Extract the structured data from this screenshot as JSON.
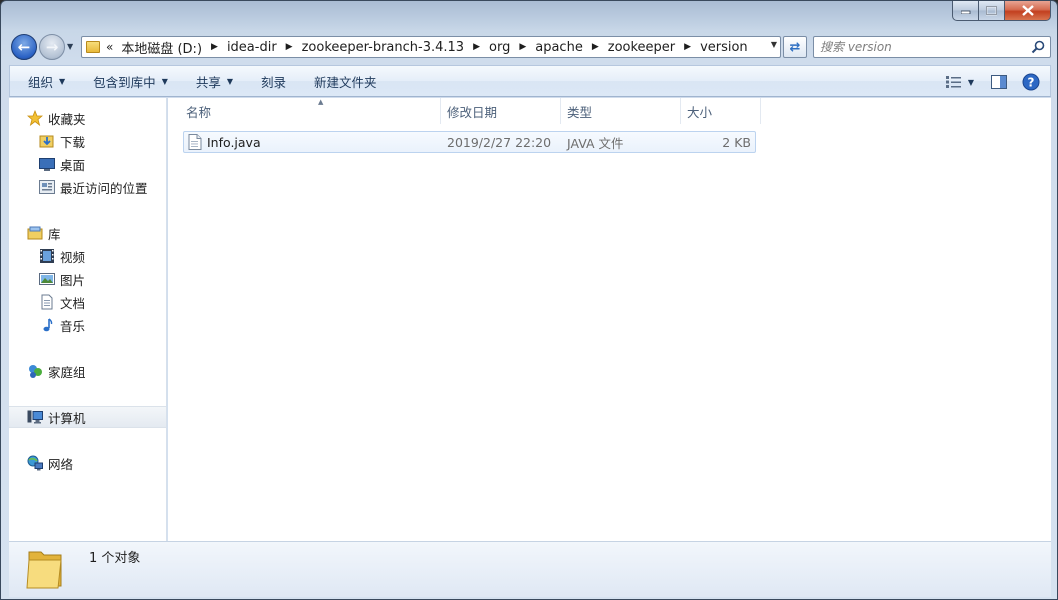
{
  "window": {
    "caption_buttons": [
      "minimize-icon",
      "maximize-icon",
      "close-icon"
    ]
  },
  "address": {
    "overflow": "«",
    "crumbs": [
      "本地磁盘 (D:)",
      "idea-dir",
      "zookeeper-branch-3.4.13",
      "org",
      "apache",
      "zookeeper",
      "version"
    ]
  },
  "search": {
    "placeholder": "搜索 version",
    "value": ""
  },
  "toolbar": {
    "organize": "组织",
    "include_in_library": "包含到库中",
    "share": "共享",
    "burn": "刻录",
    "new_folder": "新建文件夹"
  },
  "nav": {
    "favorites": {
      "label": "收藏夹",
      "items": [
        "下载",
        "桌面",
        "最近访问的位置"
      ]
    },
    "libraries": {
      "label": "库",
      "items": [
        "视频",
        "图片",
        "文档",
        "音乐"
      ]
    },
    "homegroup": "家庭组",
    "computer": "计算机",
    "network": "网络"
  },
  "columns": {
    "name": "名称",
    "modified": "修改日期",
    "type": "类型",
    "size": "大小"
  },
  "files": [
    {
      "name": "Info.java",
      "modified": "2019/2/27 22:20",
      "type": "JAVA 文件",
      "size": "2 KB"
    }
  ],
  "status": {
    "count_text": "1 个对象"
  },
  "colors": {
    "frame": "#cfdcec",
    "toolbar_text": "#1e395b",
    "selection_border": "#bcd3ef",
    "close_button": "#c2401f"
  }
}
